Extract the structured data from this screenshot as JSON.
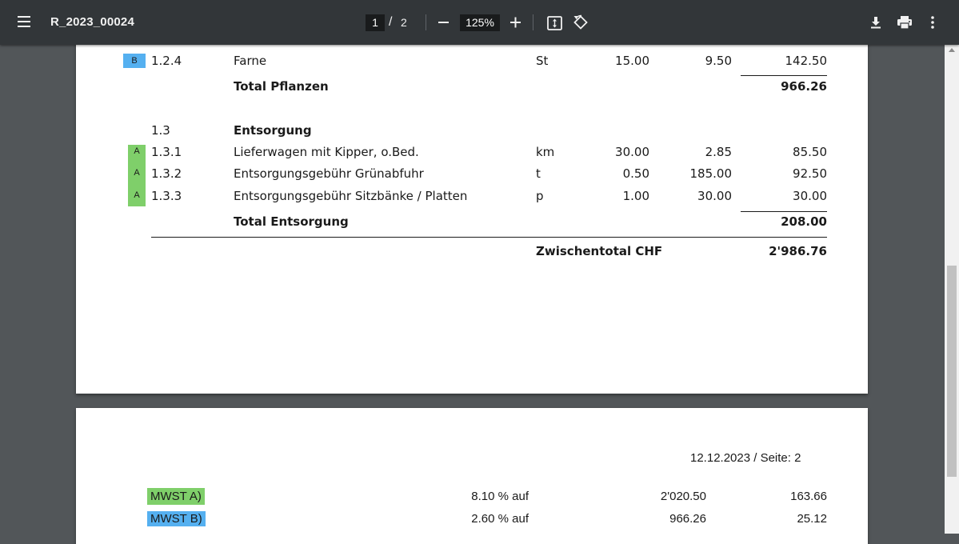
{
  "toolbar": {
    "title": "R_2023_00024",
    "current_page": "1",
    "page_separator": "/",
    "total_pages": "2",
    "zoom": "125%"
  },
  "colors": {
    "tag_A": "#7fcf6a",
    "tag_B": "#55b0f0",
    "toolbar_bg": "#323639",
    "viewer_bg": "#525659"
  },
  "page1": {
    "rows": [
      {
        "tag": "B",
        "code": "1.2.4",
        "desc": "Farne",
        "unit": "St",
        "qty": "15.00",
        "price": "9.50",
        "total": "142.50"
      },
      {
        "tag": "A",
        "code": "1.3.1",
        "desc": "Lieferwagen mit Kipper, o.Bed.",
        "unit": "km",
        "qty": "30.00",
        "price": "2.85",
        "total": "85.50"
      },
      {
        "tag": "A",
        "code": "1.3.2",
        "desc": "Entsorgungsgebühr Grünabfuhr",
        "unit": "t",
        "qty": "0.50",
        "price": "185.00",
        "total": "92.50"
      },
      {
        "tag": "A",
        "code": "1.3.3",
        "desc": "Entsorgungsgebühr Sitzbänke / Platten",
        "unit": "p",
        "qty": "1.00",
        "price": "30.00",
        "total": "30.00"
      }
    ],
    "total_pflanzen_label": "Total Pflanzen",
    "total_pflanzen_value": "966.26",
    "section_code": "1.3",
    "section_title": "Entsorgung",
    "total_entsorgung_label": "Total Entsorgung",
    "total_entsorgung_value": "208.00",
    "zwischentotal_label": "Zwischentotal CHF",
    "zwischentotal_value": "2'986.76"
  },
  "page2": {
    "date_line": "12.12.2023 / Seite: 2",
    "mwst": [
      {
        "label": "MWST A)",
        "rate": "8.10 % auf",
        "base": "2'020.50",
        "amount": "163.66"
      },
      {
        "label": "MWST B)",
        "rate": "2.60 % auf",
        "base": "966.26",
        "amount": "25.12"
      }
    ]
  }
}
